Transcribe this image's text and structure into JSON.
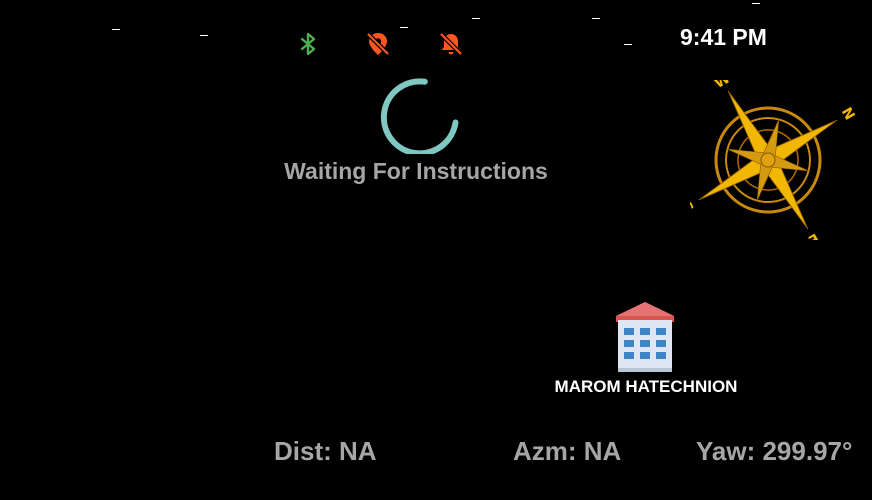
{
  "status_bar": {
    "time": "9:41 PM",
    "icons": [
      "bluetooth-icon",
      "location-off-icon",
      "notifications-off-icon"
    ],
    "colors": {
      "bluetooth": "#4caf50",
      "alert": "#ff5722"
    }
  },
  "navigation": {
    "status_text": "Waiting For Instructions",
    "spinner_color": "#7fc8c2"
  },
  "compass": {
    "labels": {
      "north": "N",
      "east": "E",
      "south": "S",
      "west": "W"
    },
    "color": "#f2b705"
  },
  "destination": {
    "icon": "building-icon",
    "name": "MAROM HATECHNION"
  },
  "readouts": {
    "distance": "Dist: NA",
    "azimuth": "Azm: NA",
    "yaw": "Yaw: 299.97°"
  }
}
